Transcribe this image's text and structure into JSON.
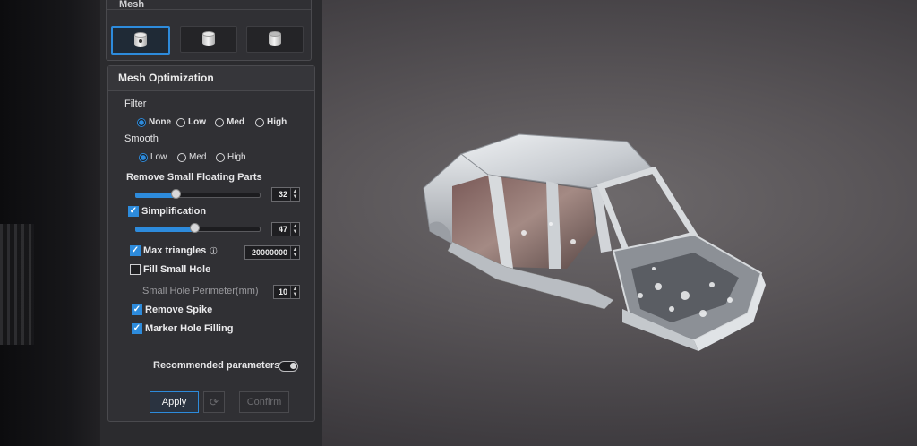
{
  "mesh_panel": {
    "title": "Mesh",
    "buttons": [
      {
        "icon": "watertight-mesh-icon",
        "active": true
      },
      {
        "icon": "semi-watertight-mesh-icon",
        "active": false
      },
      {
        "icon": "unwatertight-mesh-icon",
        "active": false
      }
    ]
  },
  "optimization": {
    "title": "Mesh Optimization",
    "filter": {
      "label": "Filter",
      "options": [
        "None",
        "Low",
        "Med",
        "High"
      ],
      "selected": "None"
    },
    "smooth": {
      "label": "Smooth",
      "options": [
        "Low",
        "Med",
        "High"
      ],
      "selected": "Low"
    },
    "remove_small_floating_parts": {
      "label": "Remove Small Floating Parts",
      "value": "32",
      "level": 0.32
    },
    "simplification": {
      "label": "Simplification",
      "checked": true,
      "value": "47",
      "level": 0.47
    },
    "max_triangles": {
      "label": "Max triangles",
      "info_icon": "ⓘ",
      "checked": true,
      "value": "20000000"
    },
    "fill_small_hole": {
      "label": "Fill Small Hole",
      "checked": false
    },
    "small_hole_perimeter": {
      "label": "Small Hole Perimeter(mm)",
      "value": "10"
    },
    "remove_spike": {
      "label": "Remove Spike",
      "checked": true
    },
    "marker_hole_filling": {
      "label": "Marker Hole Filling",
      "checked": true
    },
    "recommended_parameters": {
      "label": "Recommended parameters",
      "on": false
    },
    "actions": {
      "apply": "Apply",
      "reset_icon": "⟳",
      "confirm": "Confirm"
    }
  },
  "colors": {
    "accent": "#2d8bdc",
    "panel": "#303034",
    "viewport_bg": "#585457"
  }
}
